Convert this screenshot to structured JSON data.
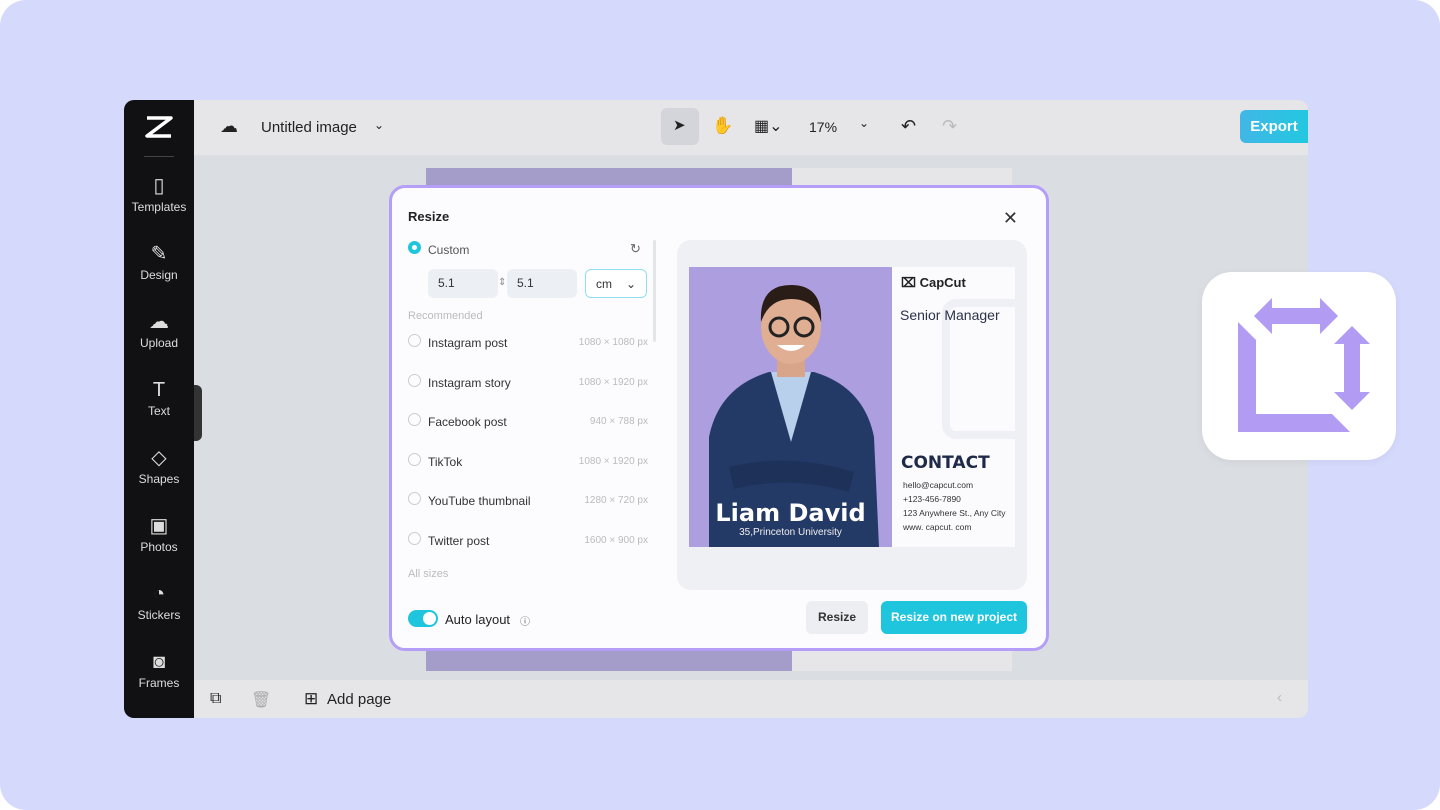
{
  "app": {
    "title": "Untitled image",
    "zoom": "17%",
    "export_label": "Export",
    "add_page_label": "Add page"
  },
  "sidebar": {
    "items": [
      {
        "label": "Templates",
        "icon": "templates-icon"
      },
      {
        "label": "Design",
        "icon": "design-icon"
      },
      {
        "label": "Upload",
        "icon": "upload-icon"
      },
      {
        "label": "Text",
        "icon": "text-icon"
      },
      {
        "label": "Shapes",
        "icon": "shapes-icon"
      },
      {
        "label": "Photos",
        "icon": "photos-icon"
      },
      {
        "label": "Stickers",
        "icon": "stickers-icon"
      },
      {
        "label": "Frames",
        "icon": "frames-icon"
      }
    ]
  },
  "dialog": {
    "title": "Resize",
    "custom_label": "Custom",
    "width": "5.1",
    "height": "5.1",
    "unit": "cm",
    "recommended_label": "Recommended",
    "options": [
      {
        "label": "Instagram post",
        "size": "1080 × 1080 px"
      },
      {
        "label": "Instagram story",
        "size": "1080 × 1920 px"
      },
      {
        "label": "Facebook post",
        "size": "940 × 788 px"
      },
      {
        "label": "TikTok",
        "size": "1080 × 1920 px"
      },
      {
        "label": "YouTube thumbnail",
        "size": "1280 × 720 px"
      },
      {
        "label": "Twitter post",
        "size": "1600 × 900 px"
      }
    ],
    "all_sizes_label": "All sizes",
    "auto_layout_label": "Auto layout",
    "auto_layout_on": true,
    "resize_label": "Resize",
    "resize_new_label": "Resize on new project"
  },
  "preview": {
    "brand": "CapCut",
    "role": "Senior Manager",
    "name": "Liam David",
    "subtitle": "35,Princeton University",
    "contact_heading": "CONTACT",
    "contact": [
      "hello@capcut.com",
      "+123-456-7890",
      "123 Anywhere St., Any City",
      "www. capcut. com"
    ]
  },
  "colors": {
    "accent": "#1fc5dd",
    "dialog_border": "#b59ef8",
    "background": "#d5d9fc"
  }
}
